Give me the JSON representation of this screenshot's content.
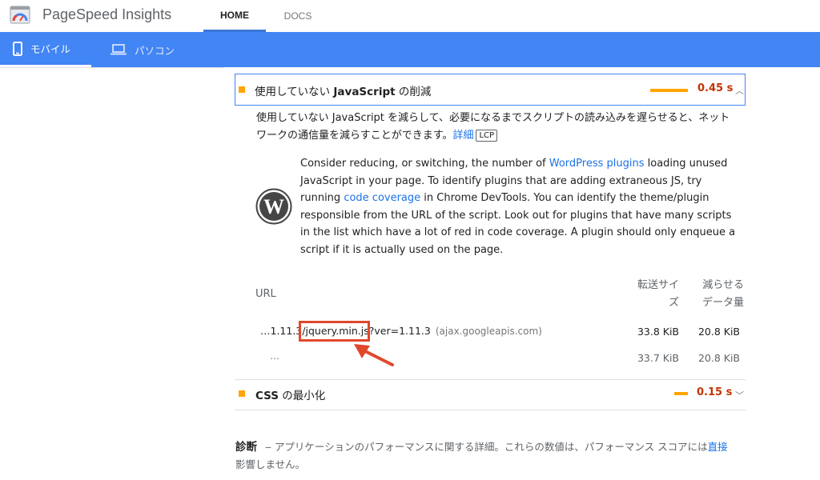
{
  "header": {
    "brand": "PageSpeed Insights",
    "nav": {
      "home": "HOME",
      "docs": "DOCS"
    }
  },
  "device_tabs": {
    "mobile": "モバイル",
    "desktop": "パソコン"
  },
  "audit_js": {
    "title_pre": "使用していない ",
    "title_bold": "JavaScript",
    "title_post": " の削減",
    "savings": "0.45 s",
    "description": "使用していない JavaScript を減らして、必要になるまでスクリプトの読み込みを遅らせると、ネットワークの通信量を減らすことができます。",
    "learn_more": "詳細",
    "lcp_badge": "LCP",
    "wp_hint": {
      "part1": "Consider reducing, or switching, the number of ",
      "link1": "WordPress plugins",
      "part2": " loading unused JavaScript in your page. To identify plugins that are adding extraneous JS, try running ",
      "link2": "code coverage",
      "part3": " in Chrome DevTools. You can identify the theme/plugin responsible from the URL of the script. Look out for plugins that have many scripts in the list which have a lot of red in code coverage. A plugin should only enqueue a script if it is actually used on the page."
    },
    "table": {
      "col_url": "URL",
      "col_transfer": [
        "転送サイ",
        "ズ"
      ],
      "col_savings": [
        "減らせる",
        "データ量"
      ],
      "row": {
        "url_prefix": "…1.11.3/",
        "url_file": "jquery.min.js",
        "url_suffix": "?ver=1.11.3",
        "host": "(ajax.googleapis.com)",
        "transfer": "33.8 KiB",
        "savings": "20.8 KiB"
      },
      "subrow": {
        "label": "…",
        "transfer": "33.7 KiB",
        "savings": "20.8 KiB"
      }
    }
  },
  "audit_css": {
    "title_bold": "CSS",
    "title_post": " の最小化",
    "savings": "0.15 s"
  },
  "diagnostics": {
    "title": "診断",
    "text": " ‒ アプリケーションのパフォーマンスに関する詳細。これらの数値は、パフォーマンス スコアには",
    "link": "直接",
    "text2": "影響しません。"
  },
  "colors": {
    "accent": "#4285f4",
    "warning": "#ffa400",
    "savings_text": "#c33300",
    "annotation": "#e0482c"
  }
}
